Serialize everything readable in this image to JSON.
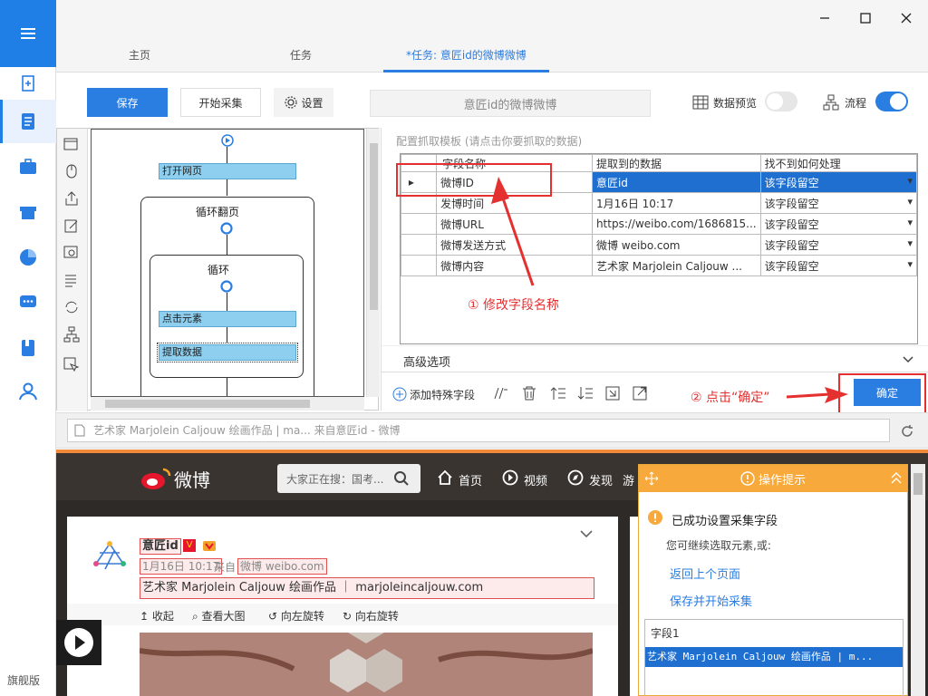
{
  "sidebar": {
    "edition_label": "旗舰版"
  },
  "tabs": {
    "home": "主页",
    "task": "任务",
    "current": "*任务: 意匠id的微博微博"
  },
  "toolbar": {
    "save": "保存",
    "start_collect": "开始采集",
    "settings": "设置",
    "task_name": "意匠id的微博微博",
    "data_preview": "数据预览",
    "flow": "流程"
  },
  "flow": {
    "open_page": "打开网页",
    "loop_page": "循环翻页",
    "loop": "循环",
    "click_element": "点击元素",
    "extract_data": "提取数据"
  },
  "config": {
    "title": "配置抓取模板 (请点击你要抓取的数据)",
    "headers": [
      "字段名称",
      "提取到的数据",
      "找不到如何处理"
    ],
    "rows": [
      {
        "name": "微博ID",
        "value": "意匠id",
        "handling": "该字段留空"
      },
      {
        "name": "发博时间",
        "value": "1月16日 10:17",
        "handling": "该字段留空"
      },
      {
        "name": "微博URL",
        "value": "https://weibo.com/1686815...",
        "handling": "该字段留空"
      },
      {
        "name": "微博发送方式",
        "value": "微博 weibo.com",
        "handling": "该字段留空"
      },
      {
        "name": "微博内容",
        "value": "艺术家 Marjolein Caljouw ...",
        "handling": "该字段留空"
      }
    ],
    "advanced": "高级选项",
    "add_special": "添加特殊字段",
    "ok": "确定"
  },
  "annotations": {
    "step1": "① 修改字段名称",
    "step2": "② 点击“确定”"
  },
  "browser": {
    "url_text": "艺术家 Marjolein Caljouw 绘画作品 | ma... 来自意匠id - 微博"
  },
  "weibo": {
    "logo_text": "微博",
    "search_placeholder": "大家正在搜：国考...",
    "nav_home": "首页",
    "nav_video": "视频",
    "nav_discover": "发现",
    "nav_game": "游",
    "user": "意匠id",
    "time": "1月16日 10:17",
    "from_prefix": "来自",
    "source": "微博 weibo.com",
    "content": "艺术家 Marjolein Caljouw 绘画作品 ｜ marjoleincaljouw.com",
    "collapse": "收起",
    "view_large": "查看大图",
    "rotate_left": "向左旋转",
    "rotate_right": "向右旋转"
  },
  "tips": {
    "title": "操作提示",
    "success": "已成功设置采集字段",
    "hint": "您可继续选取元素,或:",
    "back": "返回上个页面",
    "save_start": "保存并开始采集",
    "field_header": "字段1",
    "field_value": "艺术家 Marjolein Caljouw 绘画作品   |   m..."
  },
  "colors": {
    "accent": "#2a7de1",
    "annotation": "#e53030",
    "tips": "#f7a93b"
  }
}
